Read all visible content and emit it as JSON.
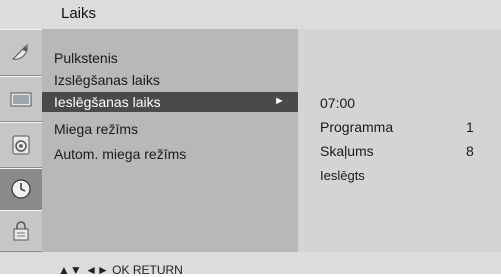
{
  "header": {
    "title": "Laiks"
  },
  "rail": {
    "icons": [
      "satellite-dish-icon",
      "tv-screen-icon",
      "speaker-icon",
      "clock-icon",
      "lock-icon"
    ],
    "selected_index": 3
  },
  "menu": {
    "items": [
      {
        "label": "Pulkstenis"
      },
      {
        "label": "Izslēgšanas laiks"
      },
      {
        "label": "Ieslēgšanas laiks",
        "selected": true
      },
      {
        "label": "Miega režīms"
      },
      {
        "label": "Autom. miega režīms"
      }
    ],
    "submenu_arrow": "►"
  },
  "detail": {
    "time": "07:00",
    "program_label": "Programma",
    "program_value": "1",
    "volume_label": "Skaļums",
    "volume_value": "8",
    "state": "Ieslēgts"
  },
  "nav_hint": "▲▼  ◄►  OK  RETURN",
  "colors": {
    "highlight": "#4a4a4a",
    "menu_bg": "#b8b8b8",
    "rail_bg": "#c6c6c6"
  }
}
